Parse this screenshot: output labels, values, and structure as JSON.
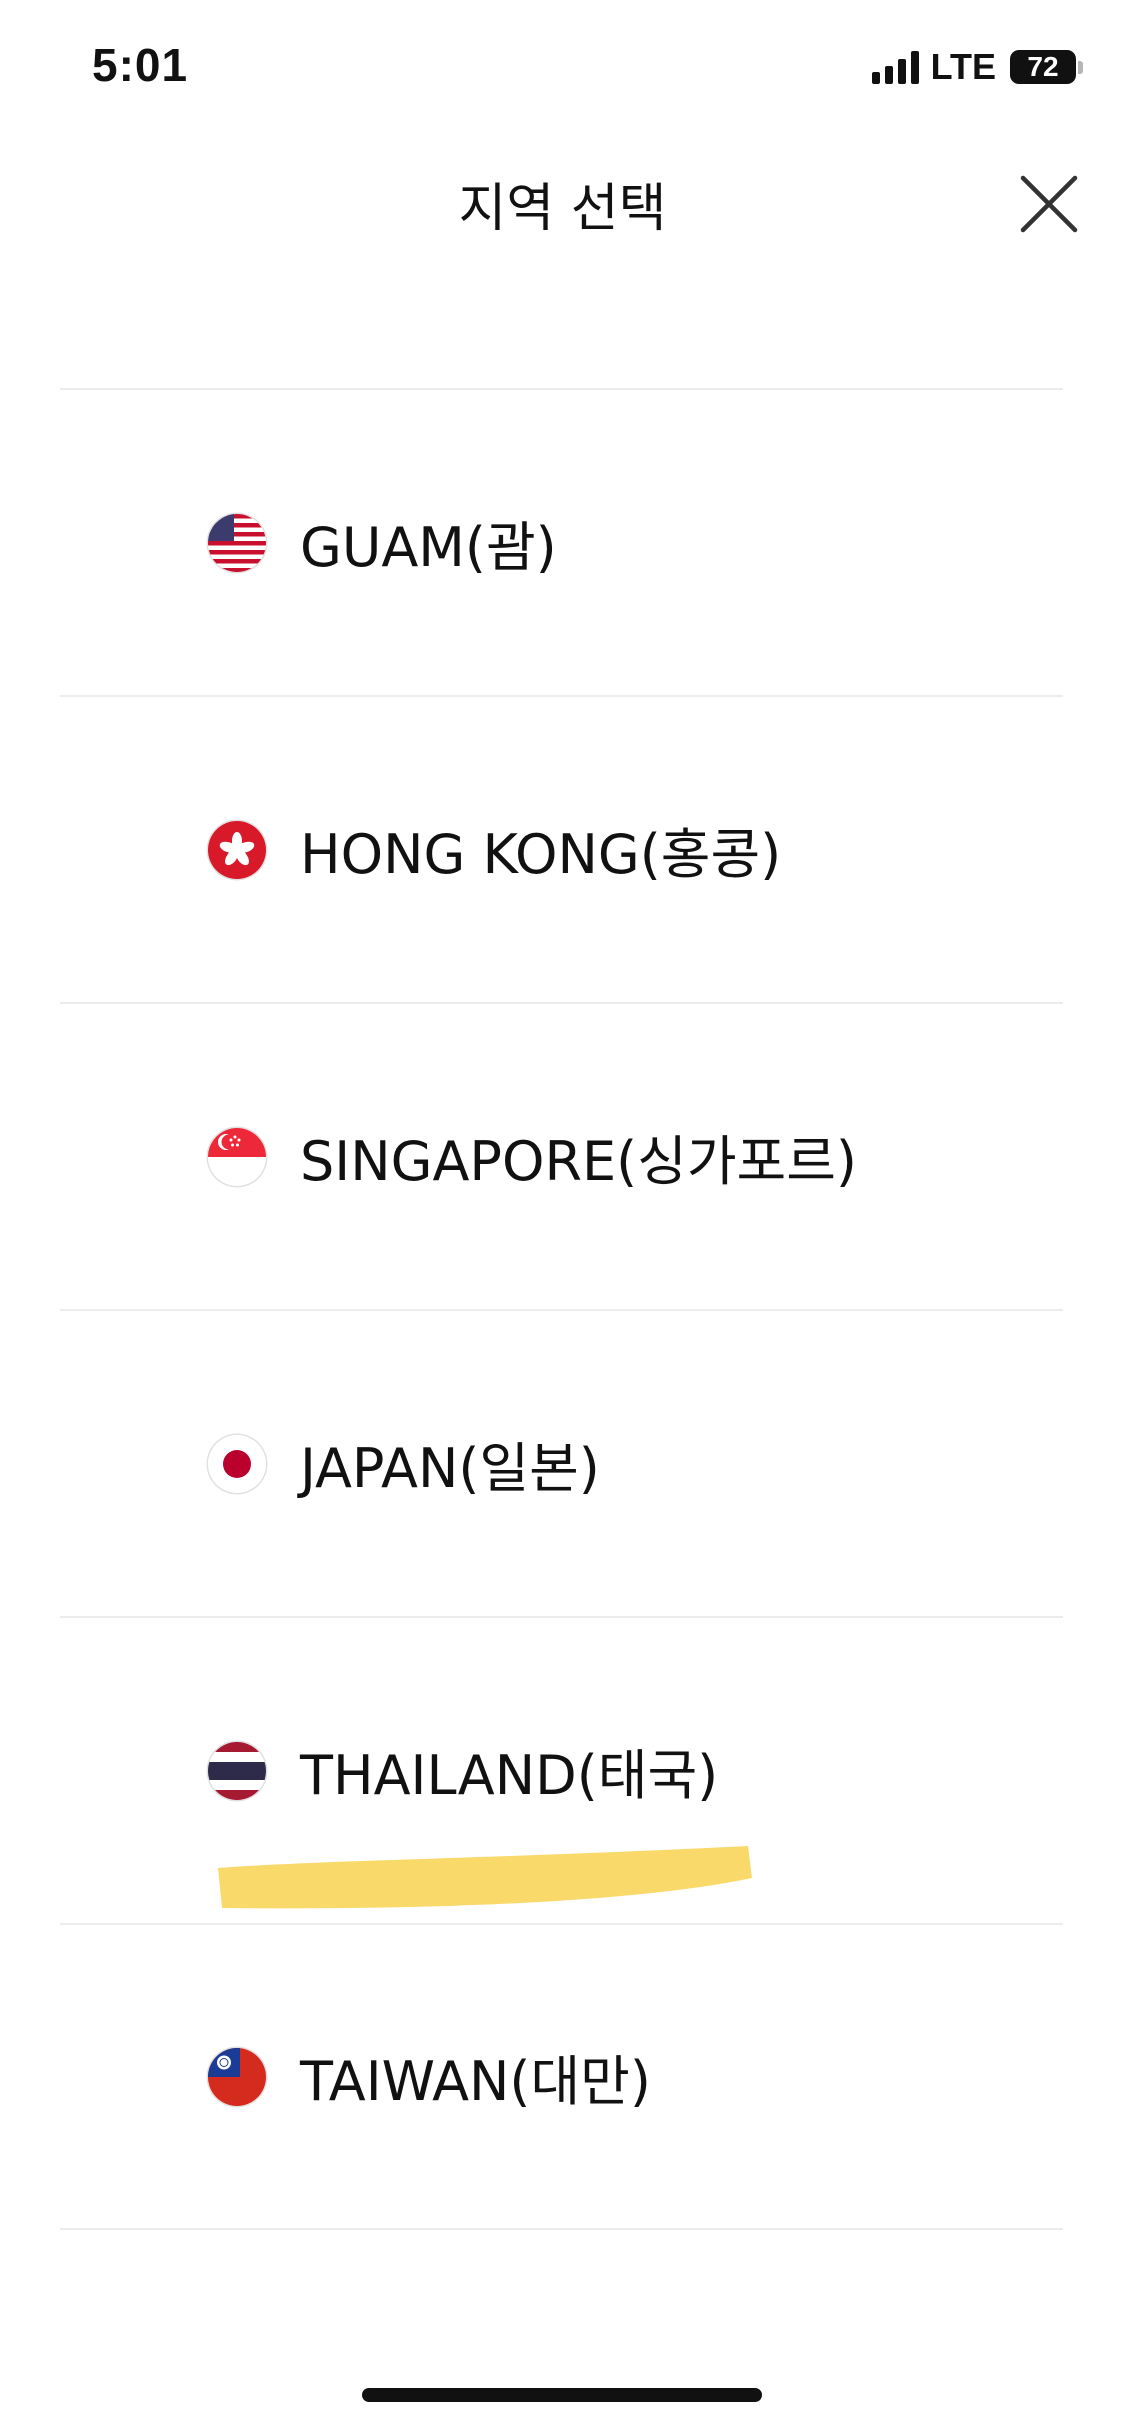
{
  "status_bar": {
    "time": "5:01",
    "network": "LTE",
    "battery": "72"
  },
  "header": {
    "title": "지역 선택"
  },
  "regions": [
    {
      "label": "GUAM(괌)",
      "flag": "us-flag-icon"
    },
    {
      "label": "HONG KONG(홍콩)",
      "flag": "hk-flag-icon"
    },
    {
      "label": "SINGAPORE(싱가포르)",
      "flag": "sg-flag-icon"
    },
    {
      "label": "JAPAN(일본)",
      "flag": "jp-flag-icon"
    },
    {
      "label": "THAILAND(태국)",
      "flag": "th-flag-icon"
    },
    {
      "label": "TAIWAN(대만)",
      "flag": "tw-flag-icon"
    }
  ],
  "colors": {
    "highlight": "#f9d65c",
    "divider": "#ececec"
  }
}
